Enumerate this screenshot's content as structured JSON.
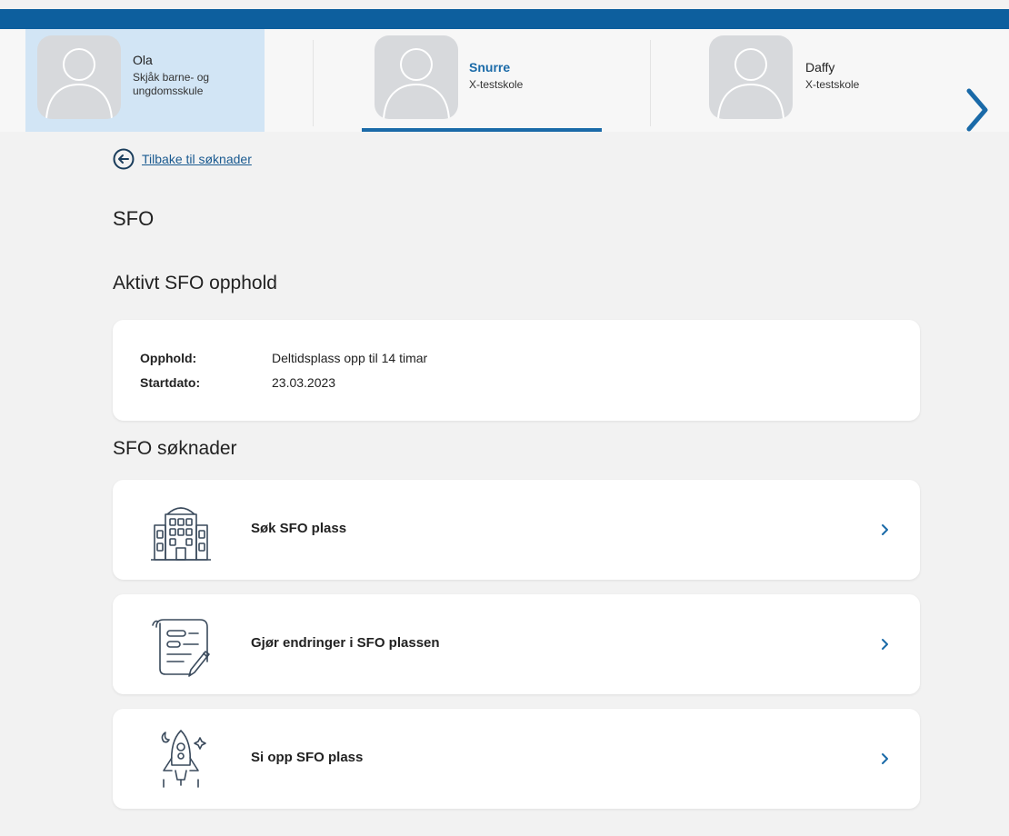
{
  "children": [
    {
      "name": "Ola",
      "school": "Skjåk barne- og ungdomsskule",
      "state": "highlighted"
    },
    {
      "name": "Snurre",
      "school": "X-testskole",
      "state": "selected"
    },
    {
      "name": "Daffy",
      "school": "X-testskole",
      "state": "normal"
    }
  ],
  "nav": {
    "back_label": "Tilbake til søknader",
    "next_icon": "chevron-right-icon"
  },
  "page": {
    "title": "SFO"
  },
  "active_stay": {
    "heading": "Aktivt SFO opphold",
    "rows": [
      {
        "label": "Opphold:",
        "value": "Deltidsplass opp til 14 timar"
      },
      {
        "label": "Startdato:",
        "value": "23.03.2023"
      }
    ]
  },
  "applications": {
    "heading": "SFO søknader",
    "items": [
      {
        "label": "Søk SFO plass",
        "icon": "school-building-icon"
      },
      {
        "label": "Gjør endringer i SFO plassen",
        "icon": "document-edit-icon"
      },
      {
        "label": "Si opp SFO plass",
        "icon": "rocket-icon"
      }
    ]
  },
  "colors": {
    "topbar": "#0d5f9e",
    "accent": "#1a6aa8",
    "selected_bg": "#d2e5f5",
    "page_bg": "#f2f2f2"
  }
}
